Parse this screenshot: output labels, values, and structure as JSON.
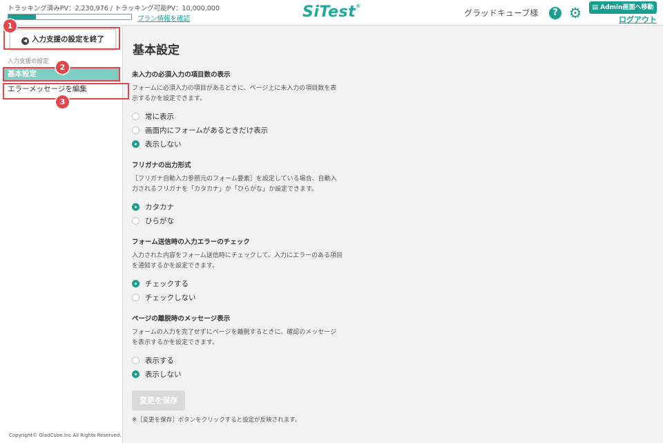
{
  "header": {
    "pv_text": "トラッキング済みPV：2,230,976 / トラッキング可能PV：10,000,000",
    "pv_progress": 0.223,
    "plan_link": "プラン情報を確認",
    "logo": "SiTest",
    "logo_mark": "®",
    "user_name": "グラッドキューブ様",
    "help_icon": "?",
    "gear_icon": "⚙",
    "admin_button": "Admin画面へ移動",
    "logout": "ログアウト"
  },
  "sidebar": {
    "end_button": "入力支援の設定を終了",
    "heading": "入力支援の設定",
    "items": [
      {
        "label": "基本設定"
      },
      {
        "label": "エラーメッセージを編集"
      }
    ],
    "copyright": "Copyright© GladCube.Inc All Rights Reserved."
  },
  "callouts": [
    "1",
    "2",
    "3"
  ],
  "main": {
    "title": "基本設定",
    "sections": [
      {
        "title": "未入力の必須入力の項目数の表示",
        "desc": "フォームに必須入力の項目があるときに、ページ上に未入力の項目数を表示するかを設定できます。",
        "options": [
          {
            "label": "常に表示",
            "checked": false
          },
          {
            "label": "画面内にフォームがあるときだけ表示",
            "checked": false
          },
          {
            "label": "表示しない",
            "checked": true
          }
        ]
      },
      {
        "title": "フリガナの出力形式",
        "desc": "［フリガナ自動入力参照元のフォーム要素］を設定している場合、自動入力されるフリガナを「カタカナ」か「ひらがな」か設定できます。",
        "options": [
          {
            "label": "カタカナ",
            "checked": true
          },
          {
            "label": "ひらがな",
            "checked": false
          }
        ]
      },
      {
        "title": "フォーム送信時の入力エラーのチェック",
        "desc": "入力された内容をフォーム送信時にチェックして、入力にエラーのある項目を通知するかを設定できます。",
        "options": [
          {
            "label": "チェックする",
            "checked": true
          },
          {
            "label": "チェックしない",
            "checked": false
          }
        ]
      },
      {
        "title": "ページの離脱時のメッセージ表示",
        "desc": "フォームの入力を完了せずにページを離脱するときに、確認のメッセージを表示するかを設定できます。",
        "options": [
          {
            "label": "表示する",
            "checked": false
          },
          {
            "label": "表示しない",
            "checked": true
          }
        ]
      }
    ],
    "save_button": "変更を保存",
    "save_note": "※［変更を保存］ボタンをクリックすると設定が反映されます。"
  },
  "colors": {
    "accent": "#1a9e8f",
    "active_item": "#7dcdc3",
    "callout": "#e0464a"
  }
}
